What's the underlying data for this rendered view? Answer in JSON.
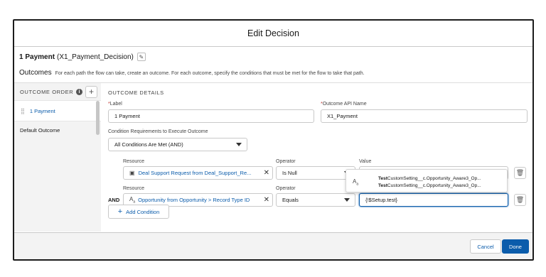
{
  "modal": {
    "title": "Edit Decision",
    "element_name": "1 Payment",
    "element_api": "(X1_Payment_Decision)",
    "outcomes_heading": "Outcomes",
    "outcomes_desc": "For each path the flow can take, create an outcome. For each outcome, specify the conditions that must be met for the flow to take that path."
  },
  "sidebar": {
    "order_label": "OUTCOME ORDER",
    "items": [
      {
        "label": "1 Payment"
      },
      {
        "label": "Default Outcome"
      }
    ]
  },
  "details": {
    "heading": "OUTCOME DETAILS",
    "label_label": "Label",
    "label_value": "1 Payment",
    "api_label": "Outcome API Name",
    "api_value": "X1_Payment",
    "cond_req_label": "Condition Requirements to Execute Outcome",
    "cond_req_value": "All Conditions Are Met (AND)",
    "conditions": [
      {
        "resource_label": "Resource",
        "resource_value": "Deal Support Request from Deal_Support_Re...",
        "operator_label": "Operator",
        "operator_value": "Is Null",
        "value_label": "Value",
        "value_value": ""
      },
      {
        "prefix": "AND",
        "resource_label": "Resource",
        "resource_value": "Opportunity from Opportunity > Record Type ID",
        "operator_label": "Operator",
        "operator_value": "Equals",
        "value_value": "{!$Setup.test}"
      }
    ],
    "add_condition_label": "Add Condition"
  },
  "autocomplete": {
    "items": [
      {
        "match": "Test",
        "rest": "CustomSetting__c.Opportunity_Aware3_Op..."
      },
      {
        "match": "Test",
        "rest": "CustomSetting__c.Opportunity_Aware3_Op..."
      }
    ]
  },
  "footer": {
    "cancel_label": "Cancel",
    "done_label": "Done"
  },
  "colors": {
    "brand": "#0b5cab",
    "required": "#c23934"
  }
}
